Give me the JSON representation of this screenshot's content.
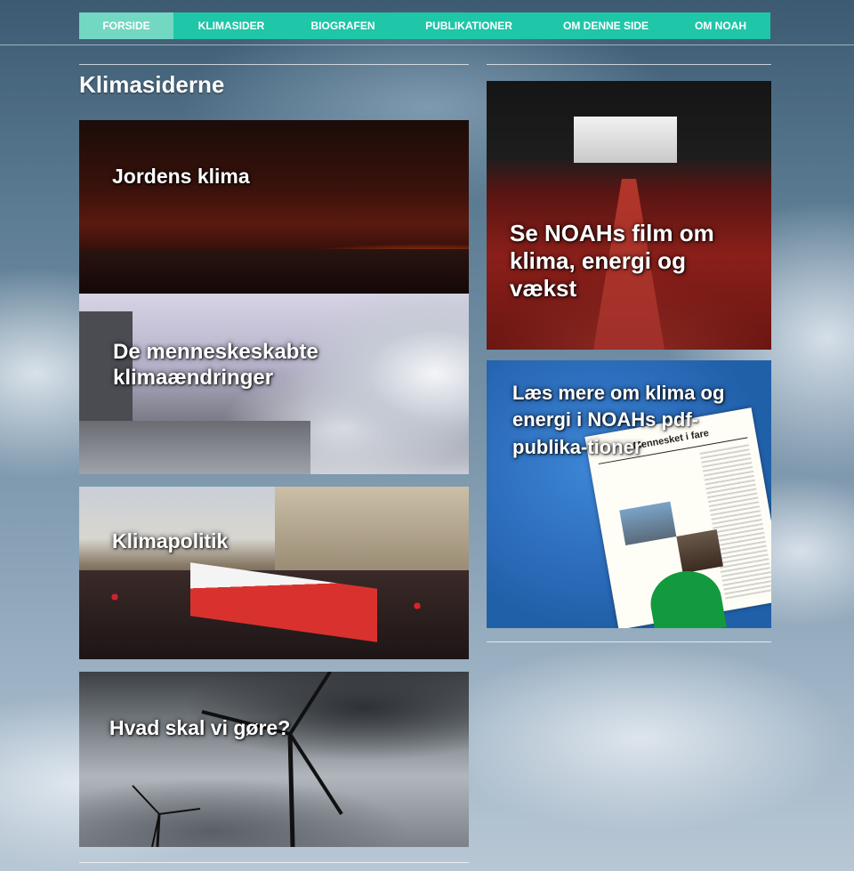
{
  "nav": {
    "items": [
      {
        "label": "FORSIDE",
        "active": true
      },
      {
        "label": "KLIMASIDER",
        "active": false
      },
      {
        "label": "BIOGRAFEN",
        "active": false
      },
      {
        "label": "PUBLIKATIONER",
        "active": false
      },
      {
        "label": "OM DENNE SIDE",
        "active": false
      },
      {
        "label": "OM NOAH",
        "active": false
      }
    ],
    "bg_color": "#1fc6a8",
    "active_color": "#72d8c2"
  },
  "page": {
    "title": "Klimasiderne"
  },
  "main_tiles": [
    {
      "caption": "Jordens klima"
    },
    {
      "caption": "De menneskeskabte klimaændringer"
    },
    {
      "caption": "Klimapolitik"
    },
    {
      "caption": "Hvad skal vi gøre?"
    }
  ],
  "side_tiles": [
    {
      "caption": "Se NOAHs film om klima, energi og vækst"
    },
    {
      "caption": "Læs mere om klima og energi i NOAHs pdf-publika-tioner",
      "doc_title": "Mennesket i fare"
    }
  ]
}
